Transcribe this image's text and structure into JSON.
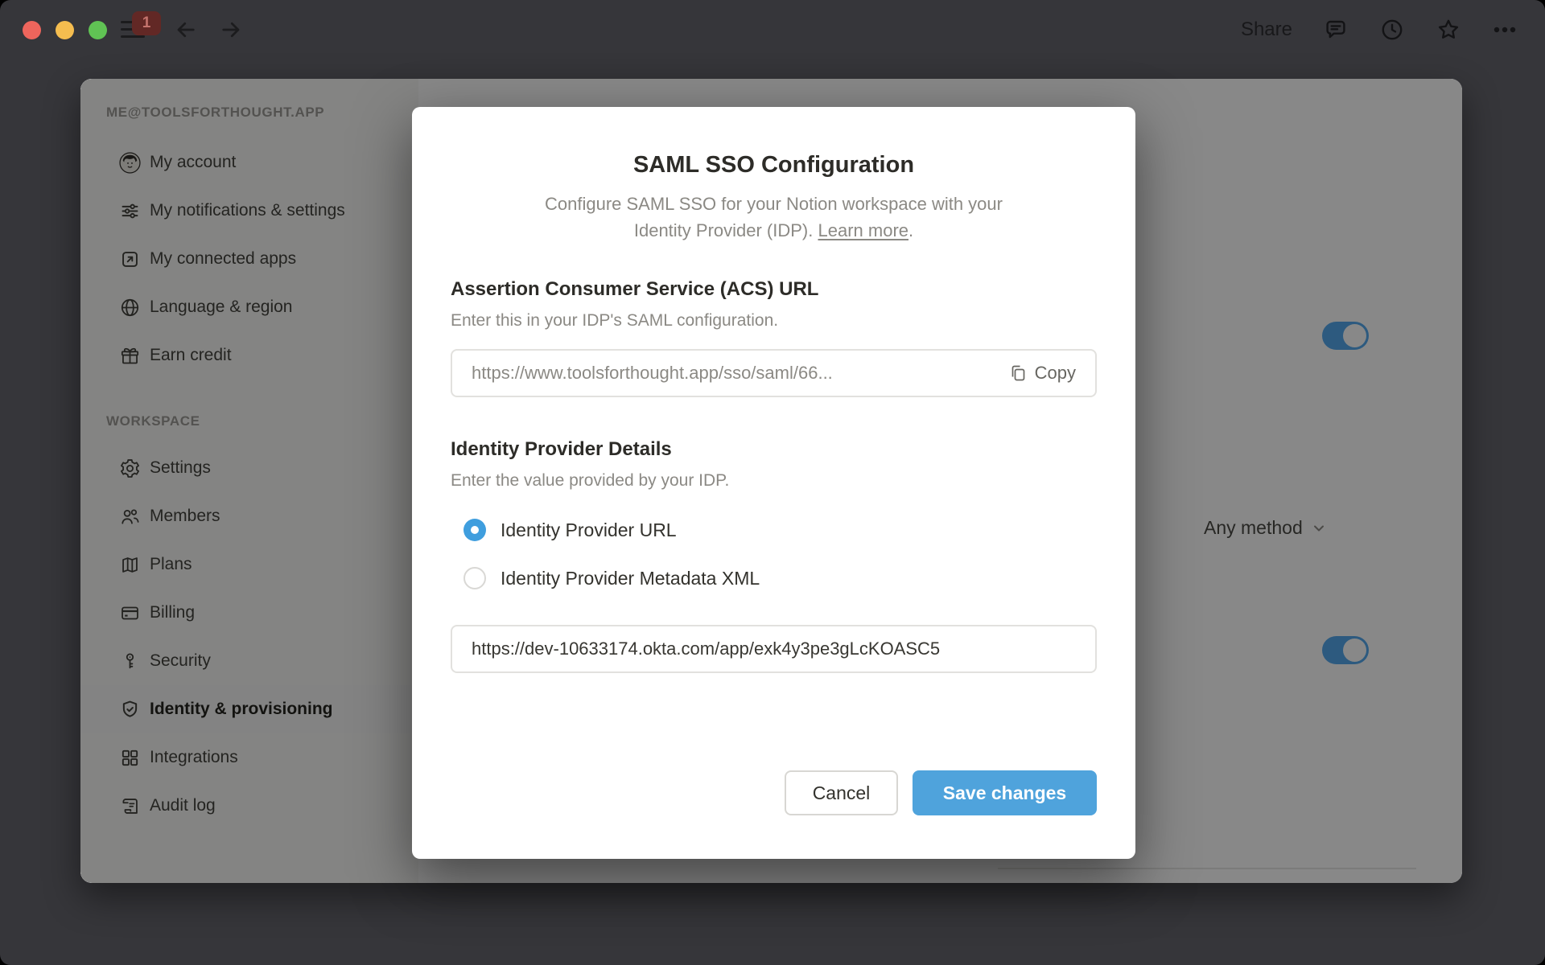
{
  "titlebar": {
    "share_label": "Share",
    "nav_badge_count": "1"
  },
  "sidebar": {
    "account_header": "ME@TOOLSFORTHOUGHT.APP",
    "workspace_header": "WORKSPACE",
    "account_items": [
      {
        "label": "My account",
        "icon": "avatar"
      },
      {
        "label": "My notifications & settings",
        "icon": "sliders"
      },
      {
        "label": "My connected apps",
        "icon": "arrow-up-right-box"
      },
      {
        "label": "Language & region",
        "icon": "globe"
      },
      {
        "label": "Earn credit",
        "icon": "gift"
      }
    ],
    "workspace_items": [
      {
        "label": "Settings",
        "icon": "gear"
      },
      {
        "label": "Members",
        "icon": "people"
      },
      {
        "label": "Plans",
        "icon": "map"
      },
      {
        "label": "Billing",
        "icon": "credit-card"
      },
      {
        "label": "Security",
        "icon": "key"
      },
      {
        "label": "Identity & provisioning",
        "icon": "shield-check",
        "active": true
      },
      {
        "label": "Integrations",
        "icon": "grid"
      },
      {
        "label": "Audit log",
        "icon": "scroll"
      }
    ]
  },
  "background_page": {
    "dropdown_value": "Any method",
    "toggle_1_state": "on",
    "toggle_2_state": "on"
  },
  "modal": {
    "title": "SAML SSO Configuration",
    "description_line1": "Configure SAML SSO for your Notion workspace with your",
    "description_line2_prefix": "Identity Provider (IDP). ",
    "learn_more_label": "Learn more",
    "description_suffix": ".",
    "acs_section": {
      "heading": "Assertion Consumer Service (ACS) URL",
      "subheading": "Enter this in your IDP's SAML configuration.",
      "url_value": "https://www.toolsforthought.app/sso/saml/66...",
      "copy_label": "Copy"
    },
    "idp_section": {
      "heading": "Identity Provider Details",
      "subheading": "Enter the value provided by your IDP.",
      "radio_options": [
        {
          "label": "Identity Provider URL",
          "selected": true
        },
        {
          "label": "Identity Provider Metadata XML",
          "selected": false
        }
      ],
      "url_value": "https://dev-10633174.okta.com/app/exk4y3pe3gLcKOASC5"
    },
    "cancel_label": "Cancel",
    "save_label": "Save changes"
  },
  "colors": {
    "accent_blue": "#4fa3dc",
    "toggle_blue_dimmed": "#2d5d80",
    "titlebar_bg": "#36363a",
    "sidebar_bg": "#f7f7f5",
    "badge_red": "#622825"
  }
}
